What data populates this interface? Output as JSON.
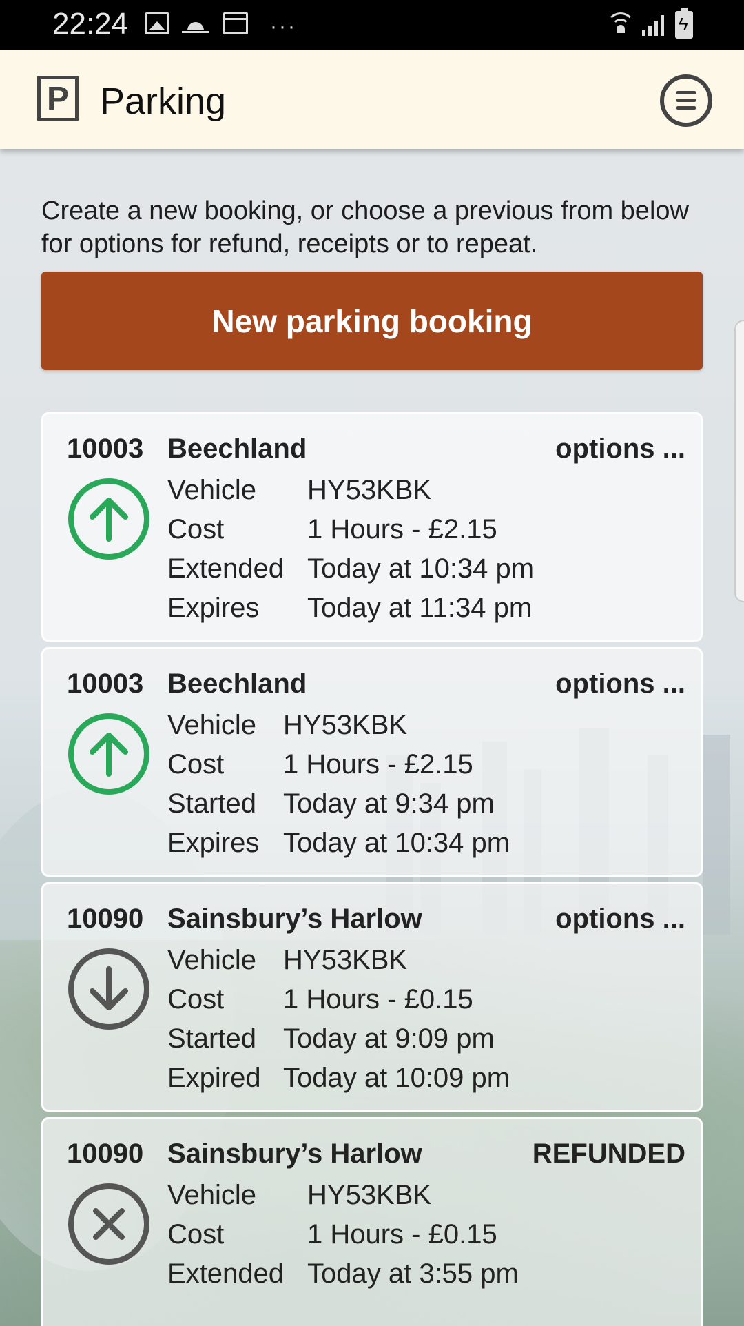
{
  "status_bar": {
    "time": "22:24",
    "icons": [
      "image-icon",
      "weather-sunrise-icon",
      "calendar-icon",
      "more-dots-icon",
      "wifi-icon",
      "signal-icon",
      "battery-charging-icon"
    ],
    "more": "···"
  },
  "app_bar": {
    "logo_letter": "P",
    "title": "Parking",
    "menu_icon": "menu-icon"
  },
  "intro_text": "Create a new booking, or choose a previous from below for options for refund, receipts or to repeat.",
  "new_booking_label": "New parking booking",
  "colors": {
    "accent": "#a4471d",
    "active": "#2aa85a",
    "inactive": "#555555",
    "app_bar_bg": "#fdf8e7"
  },
  "bookings": [
    {
      "ref": "10003",
      "location": "Beechland",
      "action": "options ...",
      "icon": "arrow-up-circle-icon",
      "rows": [
        {
          "label": "Vehicle",
          "value": "HY53KBK"
        },
        {
          "label": "Cost",
          "value": "1 Hours - £2.15"
        },
        {
          "label": "Extended",
          "value": "Today at 10:34 pm"
        },
        {
          "label": "Expires",
          "value": "Today at 11:34 pm"
        }
      ]
    },
    {
      "ref": "10003",
      "location": "Beechland",
      "action": "options ...",
      "icon": "arrow-up-circle-icon",
      "rows": [
        {
          "label": "Vehicle",
          "value": "HY53KBK"
        },
        {
          "label": "Cost",
          "value": "1 Hours - £2.15"
        },
        {
          "label": "Started",
          "value": "Today at 9:34 pm"
        },
        {
          "label": "Expires",
          "value": "Today at 10:34 pm"
        }
      ]
    },
    {
      "ref": "10090",
      "location": "Sainsbury’s Harlow",
      "action": "options ...",
      "icon": "arrow-down-circle-icon",
      "rows": [
        {
          "label": "Vehicle",
          "value": "HY53KBK"
        },
        {
          "label": "Cost",
          "value": "1 Hours - £0.15"
        },
        {
          "label": "Started",
          "value": "Today at 9:09 pm"
        },
        {
          "label": "Expired",
          "value": "Today at 10:09 pm"
        }
      ]
    },
    {
      "ref": "10090",
      "location": "Sainsbury’s Harlow",
      "action": "REFUNDED",
      "icon": "cancel-circle-icon",
      "rows": [
        {
          "label": "Vehicle",
          "value": "HY53KBK"
        },
        {
          "label": "Cost",
          "value": "1 Hours - £0.15"
        },
        {
          "label": "Extended",
          "value": "Today at 3:55 pm"
        }
      ]
    }
  ]
}
